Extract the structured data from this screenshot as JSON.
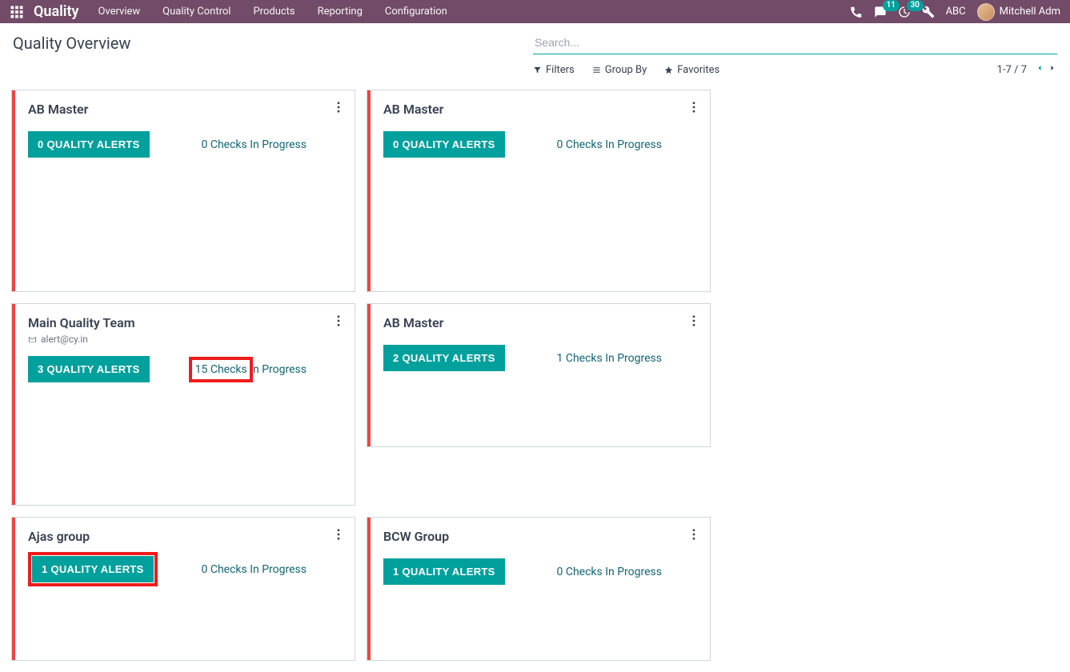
{
  "header": {
    "app_title": "Quality",
    "menu": [
      "Overview",
      "Quality Control",
      "Products",
      "Reporting",
      "Configuration"
    ],
    "messages_badge": "11",
    "activities_badge": "30",
    "company": "ABC",
    "user": "Mitchell Adm"
  },
  "control": {
    "page_title": "Quality Overview",
    "search_placeholder": "Search...",
    "filters_label": "Filters",
    "groupby_label": "Group By",
    "favorites_label": "Favorites",
    "pager": "1-7 / 7"
  },
  "cards": [
    {
      "title": "AB Master",
      "alerts": "0 QUALITY ALERTS",
      "checks": "0 Checks In Progress",
      "email": null,
      "highlight_alerts": false,
      "highlight_checks": false
    },
    {
      "title": "AB Master",
      "alerts": "0 QUALITY ALERTS",
      "checks": "0 Checks In Progress",
      "email": null,
      "highlight_alerts": false,
      "highlight_checks": false
    },
    {
      "title": "Main Quality Team",
      "alerts": "3 QUALITY ALERTS",
      "checks": "15 Checks In Progress",
      "email": "alert@cy.in",
      "highlight_alerts": false,
      "highlight_checks": true
    },
    {
      "title": "AB Master",
      "alerts": "2 QUALITY ALERTS",
      "checks": "1 Checks In Progress",
      "email": null,
      "highlight_alerts": false,
      "highlight_checks": false
    },
    {
      "title": "Ajas group",
      "alerts": "1 QUALITY ALERTS",
      "checks": "0 Checks In Progress",
      "email": null,
      "highlight_alerts": true,
      "highlight_checks": false
    },
    {
      "title": "BCW Group",
      "alerts": "1 QUALITY ALERTS",
      "checks": "0 Checks In Progress",
      "email": null,
      "highlight_alerts": false,
      "highlight_checks": false
    }
  ]
}
